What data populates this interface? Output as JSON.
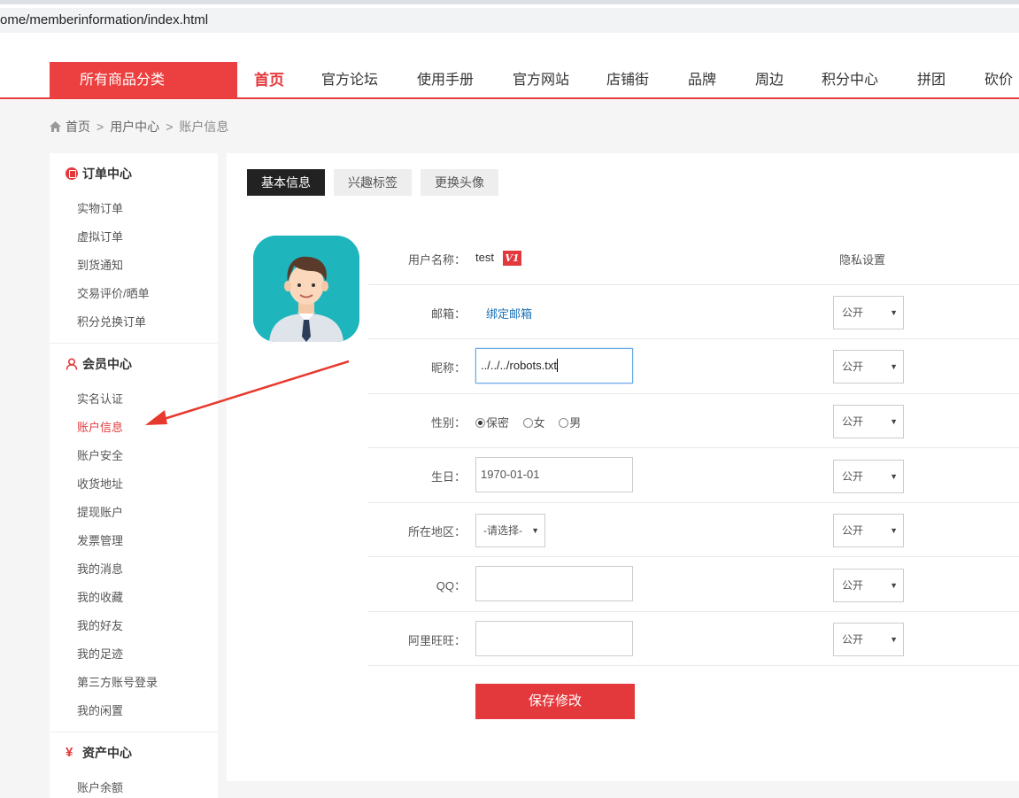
{
  "browser": {
    "url": "ome/memberinformation/index.html"
  },
  "nav": {
    "category_button": "所有商品分类",
    "items": [
      "首页",
      "官方论坛",
      "使用手册",
      "官方网站",
      "店铺街",
      "品牌",
      "周边",
      "积分中心",
      "拼团",
      "砍价"
    ]
  },
  "breadcrumb": {
    "home": "首页",
    "sep1": ">",
    "level2": "用户中心",
    "sep2": ">",
    "current": "账户信息"
  },
  "sidebar": {
    "order_center": {
      "title": "订单中心",
      "items": [
        "实物订单",
        "虚拟订单",
        "到货通知",
        "交易评价/晒单",
        "积分兑换订单"
      ]
    },
    "member_center": {
      "title": "会员中心",
      "items": [
        "实名认证",
        "账户信息",
        "账户安全",
        "收货地址",
        "提现账户",
        "发票管理",
        "我的消息",
        "我的收藏",
        "我的好友",
        "我的足迹",
        "第三方账号登录",
        "我的闲置"
      ]
    },
    "asset_center": {
      "title": "资产中心",
      "items": [
        "账户余额"
      ]
    }
  },
  "tabs": [
    "基本信息",
    "兴趣标签",
    "更换头像"
  ],
  "form": {
    "username_label": "用户名称：",
    "username_value": "test",
    "vip_badge": "V1",
    "privacy_header": "隐私设置",
    "email_label": "邮箱：",
    "email_link": "绑定邮箱",
    "nickname_label": "昵称：",
    "nickname_value": "../../../robots.txt",
    "gender_label": "性别：",
    "gender_options": [
      "保密",
      "女",
      "男"
    ],
    "birthday_label": "生日：",
    "birthday_value": "1970-01-01",
    "region_label": "所在地区：",
    "region_value": "-请选择-",
    "qq_label": "QQ：",
    "qq_value": "",
    "aliwangwang_label": "阿里旺旺：",
    "aliwangwang_value": "",
    "privacy_value": "公开",
    "save_button": "保存修改"
  },
  "colors": {
    "accent": "#e4393c",
    "annotation_arrow": "#e8392e",
    "avatar_bg": "#1fb5bd"
  }
}
